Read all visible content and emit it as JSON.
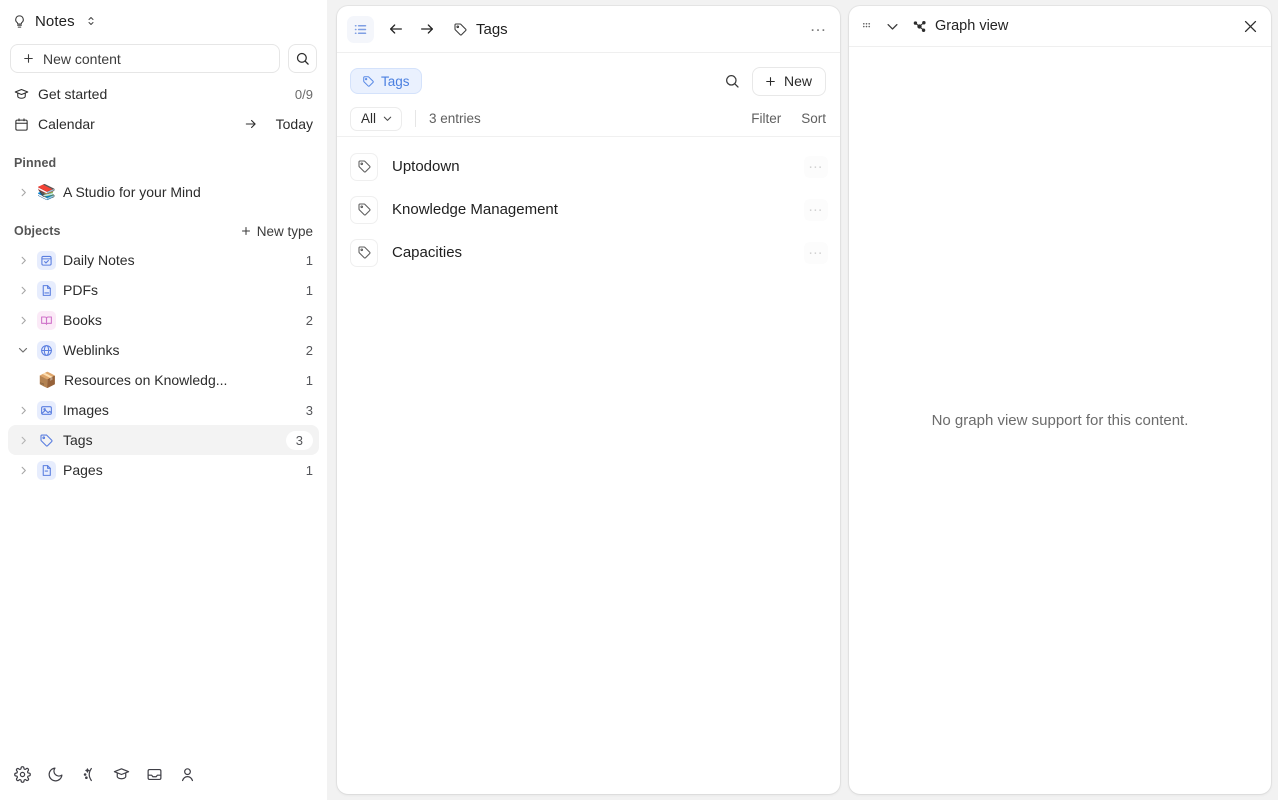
{
  "sidebar": {
    "space_name": "Notes",
    "space_icon": "lightbulb-icon",
    "new_content_label": "New content",
    "search_icon": "search-icon",
    "quick_links": [
      {
        "label": "Get started",
        "icon": "graduation-cap-icon",
        "count": "0/9"
      },
      {
        "label": "Calendar",
        "icon": "calendar-icon",
        "action": "Today"
      }
    ],
    "pinned": {
      "title": "Pinned",
      "items": [
        {
          "label": "A Studio for your Mind",
          "emoji": "📚"
        }
      ]
    },
    "objects": {
      "title": "Objects",
      "new_type_label": "New type",
      "items": [
        {
          "label": "Daily Notes",
          "count": "1",
          "icon": "calendar-check-icon",
          "expanded": false,
          "selected": false,
          "child": false
        },
        {
          "label": "PDFs",
          "count": "1",
          "icon": "pdf-file-icon",
          "expanded": false,
          "selected": false,
          "child": false
        },
        {
          "label": "Books",
          "count": "2",
          "icon": "open-book-icon",
          "expanded": false,
          "selected": false,
          "child": false
        },
        {
          "label": "Weblinks",
          "count": "2",
          "icon": "globe-icon",
          "expanded": true,
          "selected": false,
          "child": false
        },
        {
          "label": "Resources on Knowledg...",
          "count": "1",
          "icon": "package-emoji",
          "emoji": "📦",
          "expanded": null,
          "selected": false,
          "child": true
        },
        {
          "label": "Images",
          "count": "3",
          "icon": "image-icon",
          "expanded": false,
          "selected": false,
          "child": false
        },
        {
          "label": "Tags",
          "count": "3",
          "icon": "tag-icon",
          "expanded": false,
          "selected": true,
          "child": false
        },
        {
          "label": "Pages",
          "count": "1",
          "icon": "page-file-icon",
          "expanded": false,
          "selected": false,
          "child": false
        }
      ]
    },
    "bottom_icons": [
      "settings-gear-icon",
      "moon-icon",
      "ai-sparkle-icon",
      "graduation-cap-icon",
      "inbox-icon",
      "user-account-icon"
    ]
  },
  "center": {
    "toolbar": {
      "list_view_icon": "list-view-icon",
      "back_icon": "arrow-left-icon",
      "forward_icon": "arrow-right-icon",
      "breadcrumb_icon": "tag-icon",
      "breadcrumb_label": "Tags",
      "more_icon": "ellipsis-icon"
    },
    "filter": {
      "chip_label": "Tags",
      "chip_icon": "tag-icon",
      "search_icon": "search-icon",
      "new_label": "New",
      "chip_color": "#4a7fe0",
      "chip_bg": "#eaf1fe"
    },
    "meta": {
      "scope_label": "All",
      "entries_label": "3 entries",
      "filter_label": "Filter",
      "sort_label": "Sort"
    },
    "entries": [
      {
        "name": "Uptodown",
        "icon": "tag-icon"
      },
      {
        "name": "Knowledge Management",
        "icon": "tag-icon"
      },
      {
        "name": "Capacities",
        "icon": "tag-icon"
      }
    ]
  },
  "right": {
    "grip_icon": "drag-grip-icon",
    "collapse_icon": "chevron-down-icon",
    "title_icon": "graph-node-icon",
    "title": "Graph view",
    "close_icon": "close-icon",
    "empty_message": "No graph view support for this content."
  }
}
